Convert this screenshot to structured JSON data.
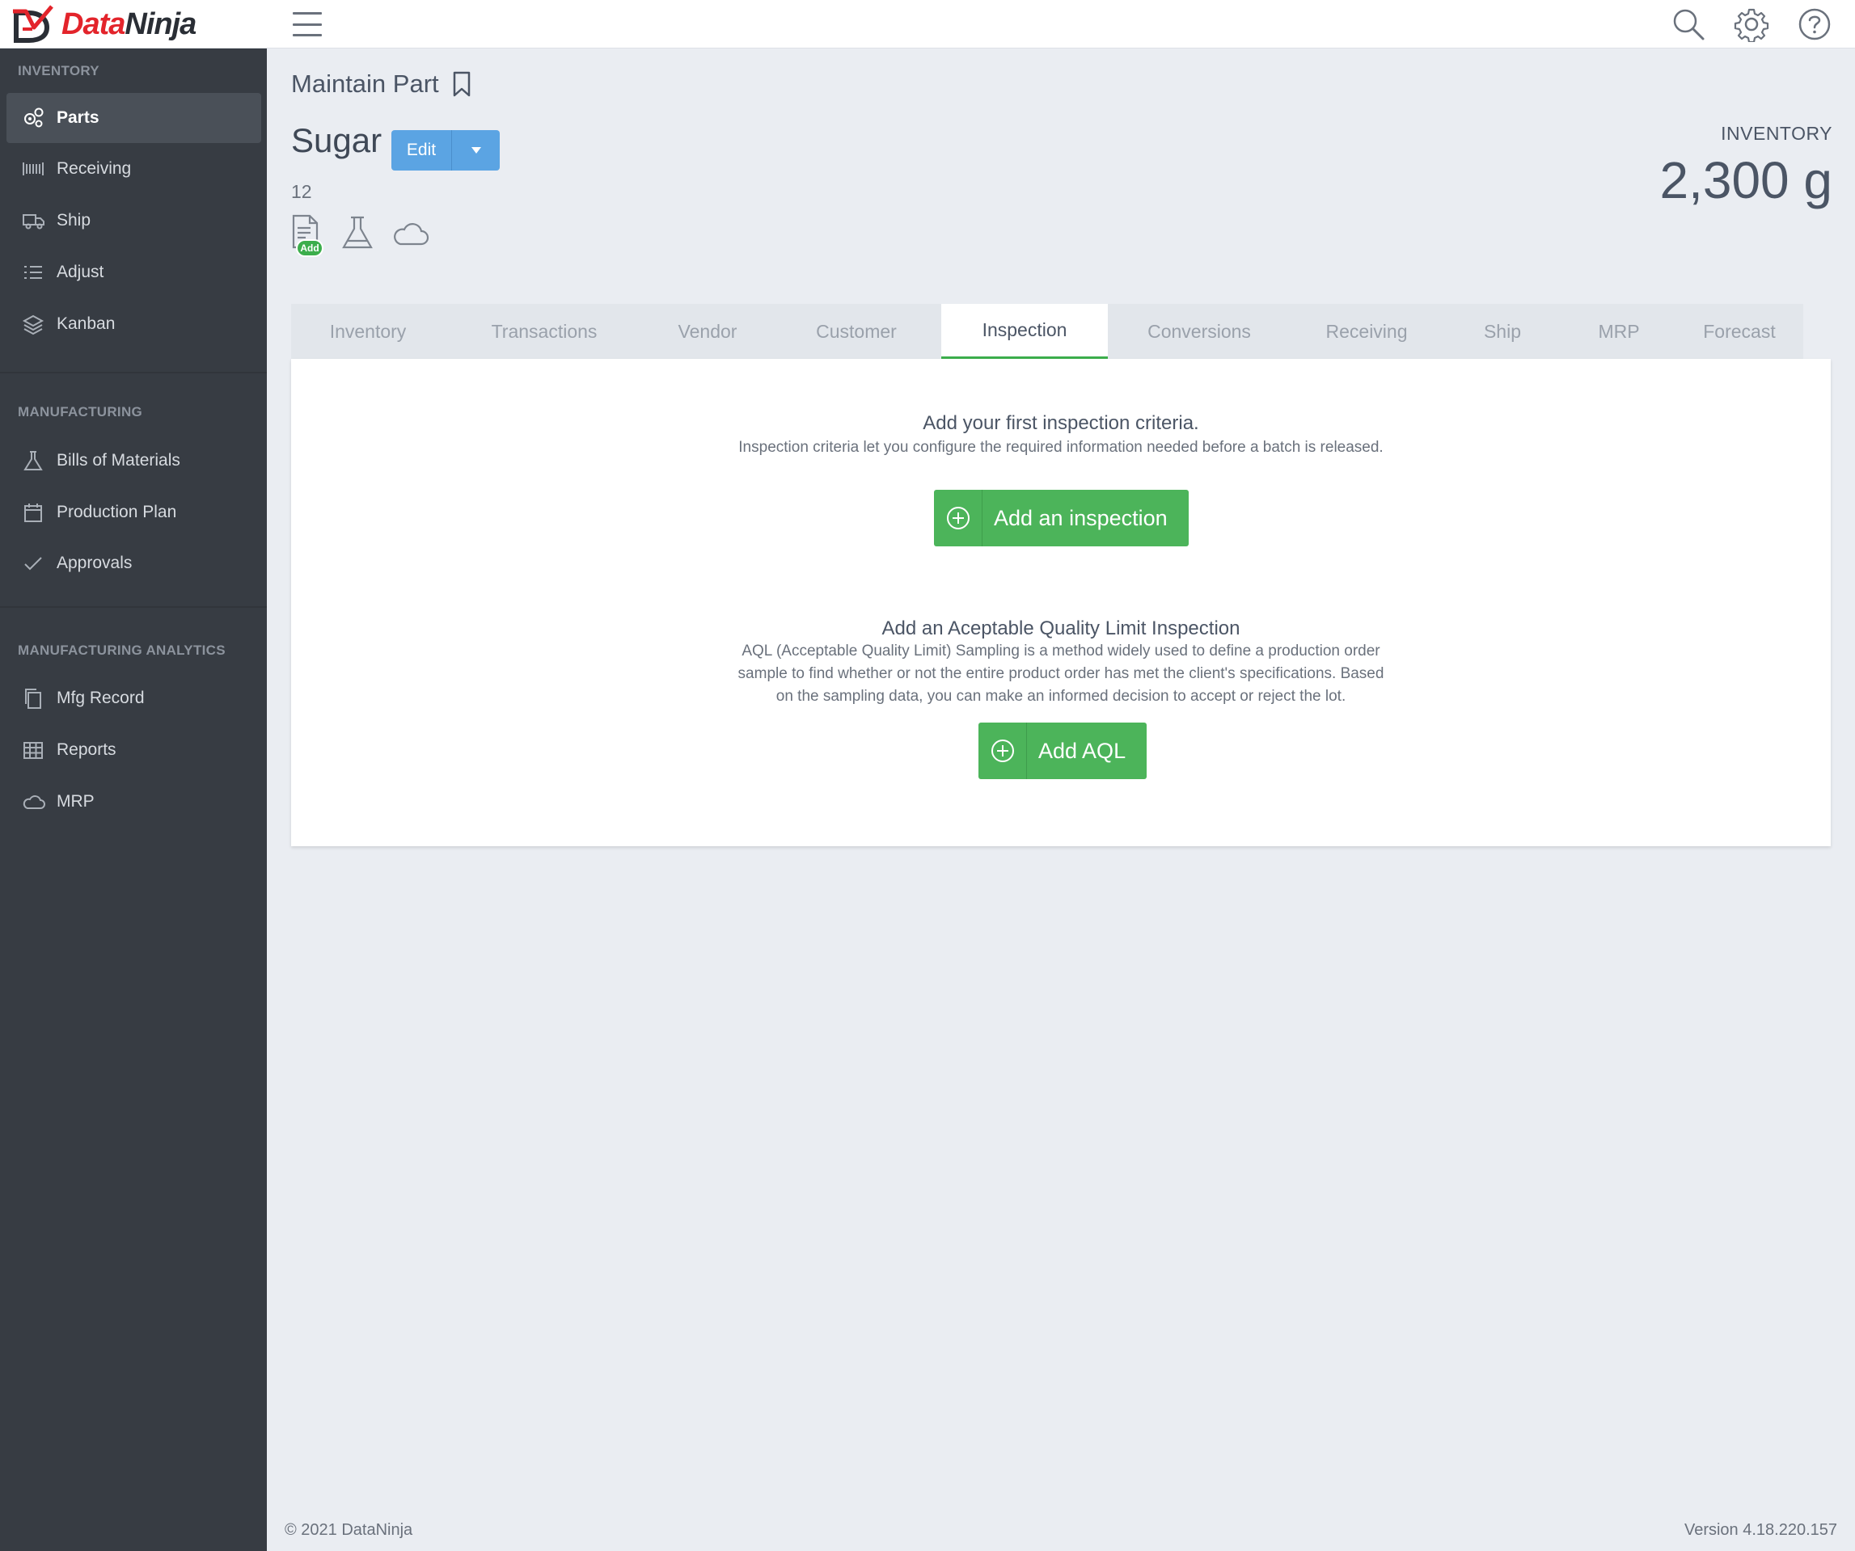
{
  "app": {
    "logo_text_a": "Data",
    "logo_text_b": "Ninja",
    "brand_red": "#e3242b",
    "accent_green": "#4cb45a",
    "accent_blue": "#5ba4e3"
  },
  "topbar": {
    "icons": [
      "menu-icon",
      "search-icon",
      "gear-icon",
      "help-icon"
    ]
  },
  "sidebar": {
    "sections": [
      {
        "title": "INVENTORY",
        "items": [
          {
            "label": "Parts",
            "icon": "gears-icon",
            "active": true
          },
          {
            "label": "Receiving",
            "icon": "barcode-icon"
          },
          {
            "label": "Ship",
            "icon": "truck-icon"
          },
          {
            "label": "Adjust",
            "icon": "list-icon"
          },
          {
            "label": "Kanban",
            "icon": "layers-icon"
          }
        ]
      },
      {
        "title": "MANUFACTURING",
        "items": [
          {
            "label": "Bills of Materials",
            "icon": "flask-icon"
          },
          {
            "label": "Production Plan",
            "icon": "calendar-icon"
          },
          {
            "label": "Approvals",
            "icon": "check-icon"
          }
        ]
      },
      {
        "title": "MANUFACTURING ANALYTICS",
        "items": [
          {
            "label": "Mfg Record",
            "icon": "copy-icon"
          },
          {
            "label": "Reports",
            "icon": "table-icon"
          },
          {
            "label": "MRP",
            "icon": "cloud-icon"
          }
        ]
      }
    ]
  },
  "header": {
    "title": "Maintain Part",
    "part_name": "Sugar",
    "edit_label": "Edit",
    "part_number": "12",
    "add_badge": "Add",
    "inventory_label": "INVENTORY",
    "inventory_value": "2,300 g"
  },
  "tabs": [
    {
      "label": "Inventory"
    },
    {
      "label": "Transactions"
    },
    {
      "label": "Vendor"
    },
    {
      "label": "Customer"
    },
    {
      "label": "Inspection",
      "active": true
    },
    {
      "label": "Conversions"
    },
    {
      "label": "Receiving"
    },
    {
      "label": "Ship"
    },
    {
      "label": "MRP"
    },
    {
      "label": "Forecast"
    }
  ],
  "inspection": {
    "title": "Add your first inspection criteria.",
    "text": "Inspection criteria let you configure the required information needed before a batch is released.",
    "button": "Add an inspection"
  },
  "aql": {
    "title": "Add an Aceptable Quality Limit Inspection",
    "lines": [
      "AQL (Acceptable Quality Limit) Sampling is a method widely used to define a production order",
      "sample to find whether or not the entire product order has met the client's specifications. Based",
      "on the sampling data, you can make an informed decision to accept or reject the lot."
    ],
    "button": "Add AQL"
  },
  "footer": {
    "copyright": "© 2021 DataNinja",
    "version": "Version 4.18.220.157"
  }
}
